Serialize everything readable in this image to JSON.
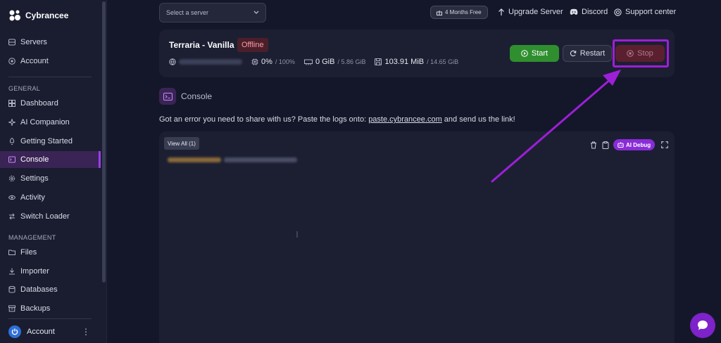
{
  "sidebar": {
    "brand": "Cybrancee",
    "top_items": [
      {
        "label": "Servers",
        "icon": "server-icon"
      },
      {
        "label": "Account",
        "icon": "account-icon"
      }
    ],
    "general_label": "GENERAL",
    "general_items": [
      {
        "label": "Dashboard",
        "icon": "dashboard-icon"
      },
      {
        "label": "AI Companion",
        "icon": "ai-icon"
      },
      {
        "label": "Getting Started",
        "icon": "rocket-icon"
      },
      {
        "label": "Console",
        "icon": "terminal-icon",
        "active": true
      },
      {
        "label": "Settings",
        "icon": "gear-icon"
      },
      {
        "label": "Activity",
        "icon": "eye-icon"
      },
      {
        "label": "Switch Loader",
        "icon": "switch-icon"
      }
    ],
    "management_label": "MANAGEMENT",
    "management_items": [
      {
        "label": "Files",
        "icon": "folder-icon"
      },
      {
        "label": "Importer",
        "icon": "download-icon"
      },
      {
        "label": "Databases",
        "icon": "database-icon"
      },
      {
        "label": "Backups",
        "icon": "archive-icon"
      }
    ],
    "account_label": "Account"
  },
  "topbar": {
    "server_select_placeholder": "Select a server",
    "promo": "4 Months Free",
    "upgrade": "Upgrade Server",
    "discord": "Discord",
    "support": "Support center"
  },
  "server": {
    "name": "Terraria - Vanilla",
    "status": "Offline",
    "cpu_value": "0%",
    "cpu_limit": "/ 100%",
    "memory_value": "0 GiB",
    "memory_limit": "/ 5.86 GiB",
    "disk_value": "103.91 MiB",
    "disk_limit": "/ 14.65 GiB",
    "start_label": "Start",
    "restart_label": "Restart",
    "stop_label": "Stop"
  },
  "console": {
    "title": "Console",
    "share_prefix": "Got an error you need to share with us? Paste the logs onto: ",
    "share_link": "paste.cybrancee.com",
    "share_suffix": " and send us the link!",
    "view_all": "View All (1)",
    "ai_debug": "AI Debug"
  },
  "colors": {
    "accent": "#9b3df0",
    "start": "#2f8f2f",
    "stop": "#5a2030",
    "offline": "#ff9aa8"
  }
}
